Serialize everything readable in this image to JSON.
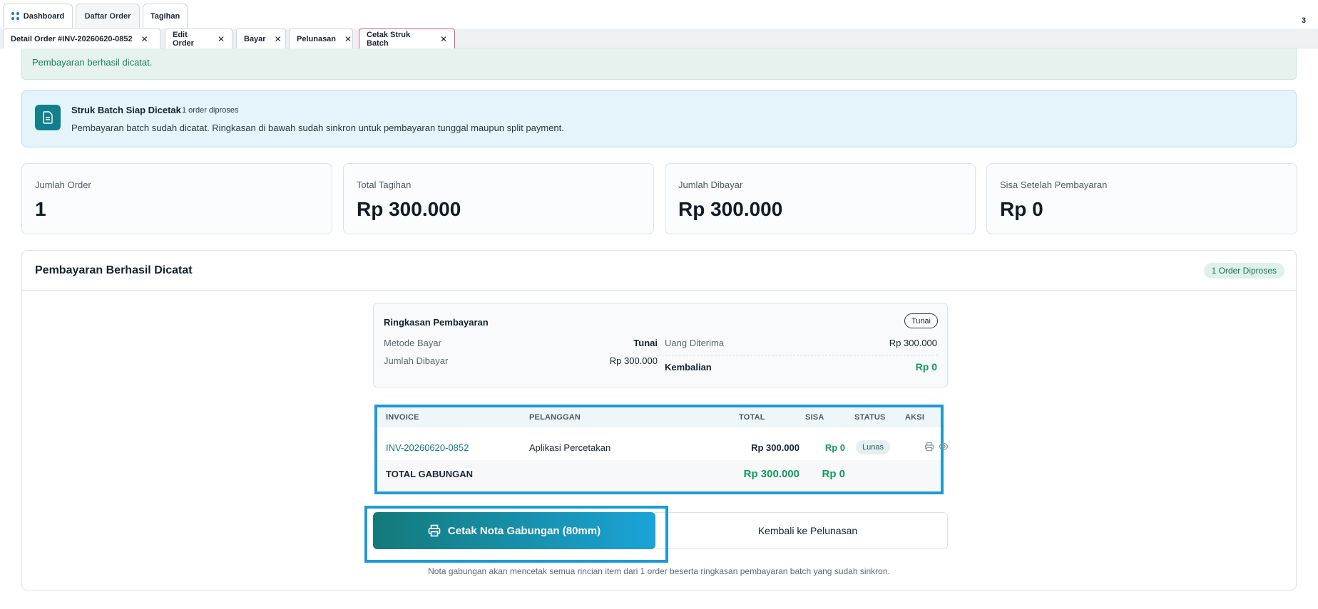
{
  "topbar": {
    "tabs": [
      {
        "label": "Dashboard",
        "icon": "dashboard-icon"
      },
      {
        "label": "Daftar Order"
      },
      {
        "label": "Tagihan"
      }
    ],
    "counter": "3"
  },
  "subtabs": [
    {
      "label": "Detail Order #INV-20260620-0852"
    },
    {
      "label": "Edit Order"
    },
    {
      "label": "Bayar"
    },
    {
      "label": "Pelunasan"
    },
    {
      "label": "Cetak Struk Batch",
      "active": true
    }
  ],
  "success_message": "Pembayaran berhasil dicatat.",
  "info": {
    "title": "Struk Batch Siap Dicetak",
    "badge": "1 order diproses",
    "description": "Pembayaran batch sudah dicatat. Ringkasan di bawah sudah sinkron untuk pembayaran tunggal maupun split payment.",
    "icon": "document-icon"
  },
  "stats": [
    {
      "label": "Jumlah Order",
      "value": "1"
    },
    {
      "label": "Total Tagihan",
      "value": "Rp 300.000"
    },
    {
      "label": "Jumlah Dibayar",
      "value": "Rp 300.000"
    },
    {
      "label": "Sisa Setelah Pembayaran",
      "value": "Rp 0"
    }
  ],
  "panel": {
    "title": "Pembayaran Berhasil Dicatat",
    "badge": "1 Order Diproses"
  },
  "summary": {
    "title": "Ringkasan Pembayaran",
    "method_pill": "Tunai",
    "metode_label": "Metode Bayar",
    "metode_value": "Tunai",
    "dibayar_label": "Jumlah Dibayar",
    "dibayar_value": "Rp 300.000",
    "diterima_label": "Uang Diterima",
    "diterima_value": "Rp 300.000",
    "kembalian_label": "Kembalian",
    "kembalian_value": "Rp 0"
  },
  "table": {
    "headers": [
      "INVOICE",
      "PELANGGAN",
      "TOTAL",
      "SISA",
      "STATUS",
      "AKSI"
    ],
    "rows": [
      {
        "invoice": "INV-20260620-0852",
        "pelanggan": "Aplikasi Percetakan",
        "total": "Rp 300.000",
        "sisa": "Rp 0",
        "status": "Lunas"
      }
    ],
    "total_label": "TOTAL GABUNGAN",
    "total_value": "Rp 300.000",
    "total_sisa": "Rp 0"
  },
  "actions": {
    "print_label": "Cetak Nota Gabungan (80mm)",
    "back_label": "Kembali ke Pelunasan"
  },
  "footnote": "Nota gabungan akan mencetak semua rincian item dari 1 order beserta ringkasan pembayaran batch yang sudah sinkron.",
  "colors": {
    "accent": "#12808a",
    "highlight": "#1b9ad7",
    "success": "#149a5a"
  }
}
